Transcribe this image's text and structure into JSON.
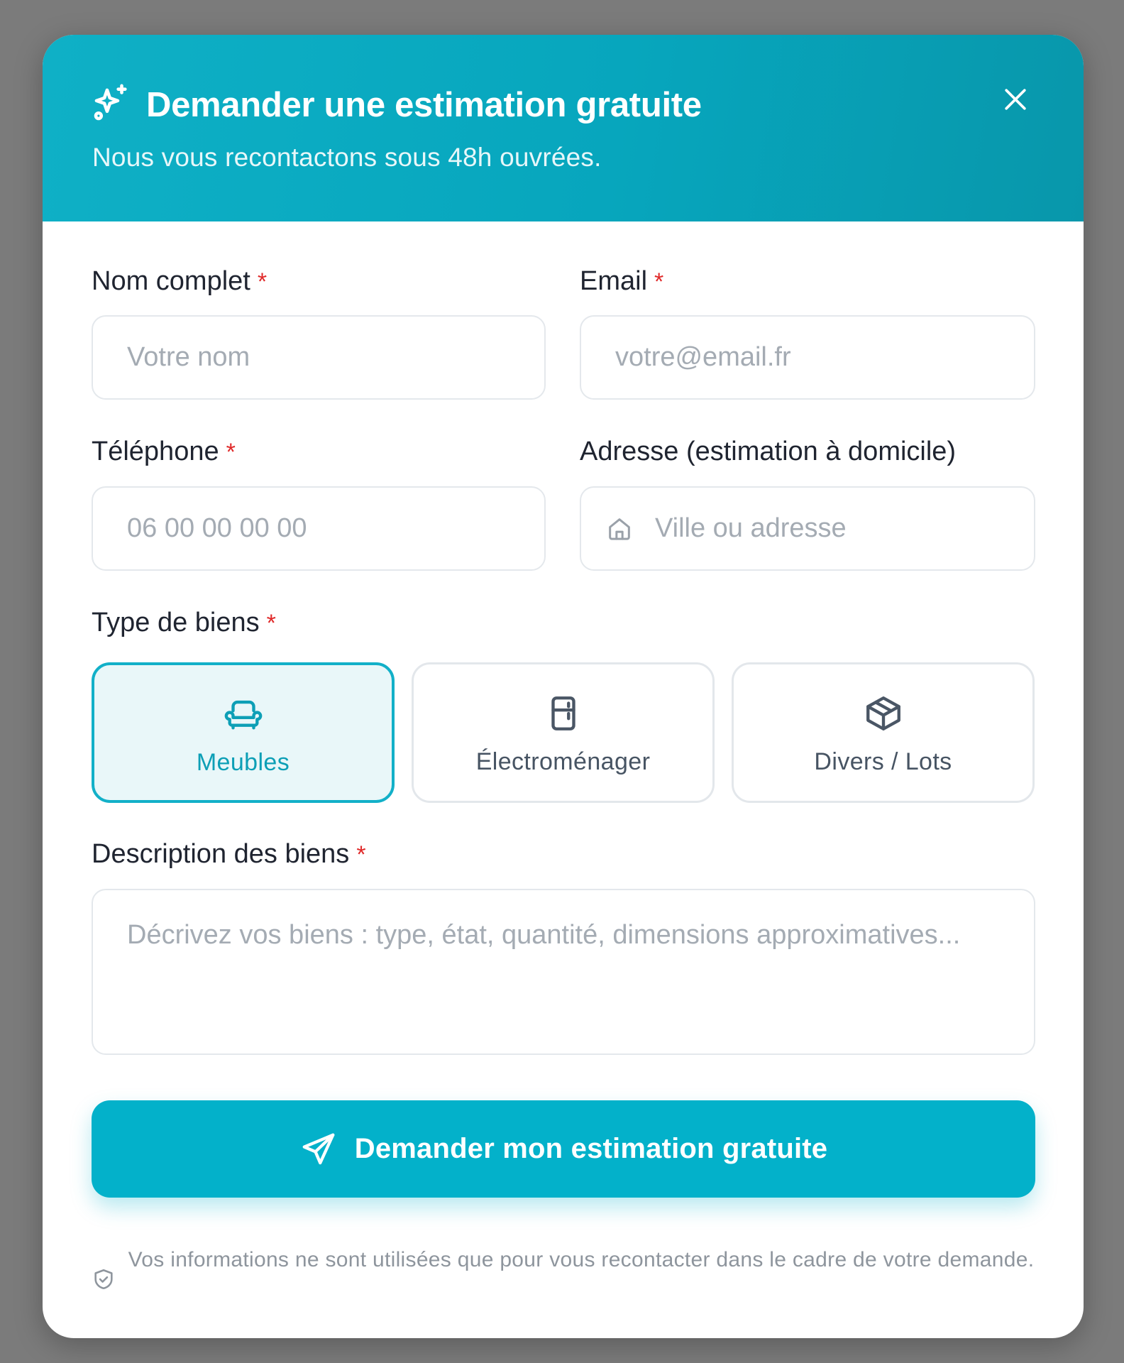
{
  "modal": {
    "title": "Demander une estimation gratuite",
    "subtitle": "Nous vous recontactons sous 48h ouvrées.",
    "close_icon": "close-icon",
    "title_icon": "sparkles-icon",
    "accent_color": "#03b1ca"
  },
  "form": {
    "name": {
      "label": "Nom complet",
      "required": "*",
      "placeholder": "Votre nom",
      "value": ""
    },
    "email": {
      "label": "Email",
      "required": "*",
      "placeholder": "votre@email.fr",
      "value": ""
    },
    "phone": {
      "label": "Téléphone",
      "required": "*",
      "placeholder": "06 00 00 00 00",
      "value": ""
    },
    "address": {
      "label": "Adresse (estimation à domicile)",
      "placeholder": "Ville ou adresse",
      "value": "",
      "icon": "home-icon"
    },
    "type": {
      "label": "Type de biens",
      "required": "*",
      "options": [
        {
          "label": "Meubles",
          "icon": "sofa-icon",
          "selected": true
        },
        {
          "label": "Électroménager",
          "icon": "fridge-icon",
          "selected": false
        },
        {
          "label": "Divers / Lots",
          "icon": "package-icon",
          "selected": false
        }
      ]
    },
    "description": {
      "label": "Description des biens",
      "required": "*",
      "placeholder": "Décrivez vos biens : type, état, quantité, dimensions approximatives...",
      "value": ""
    },
    "submit_label": "Demander mon estimation gratuite",
    "submit_icon": "send-icon",
    "privacy_text": "Vos informations ne sont utilisées que pour vous recontacter dans le cadre de votre demande.",
    "privacy_icon": "shield-check-icon"
  }
}
